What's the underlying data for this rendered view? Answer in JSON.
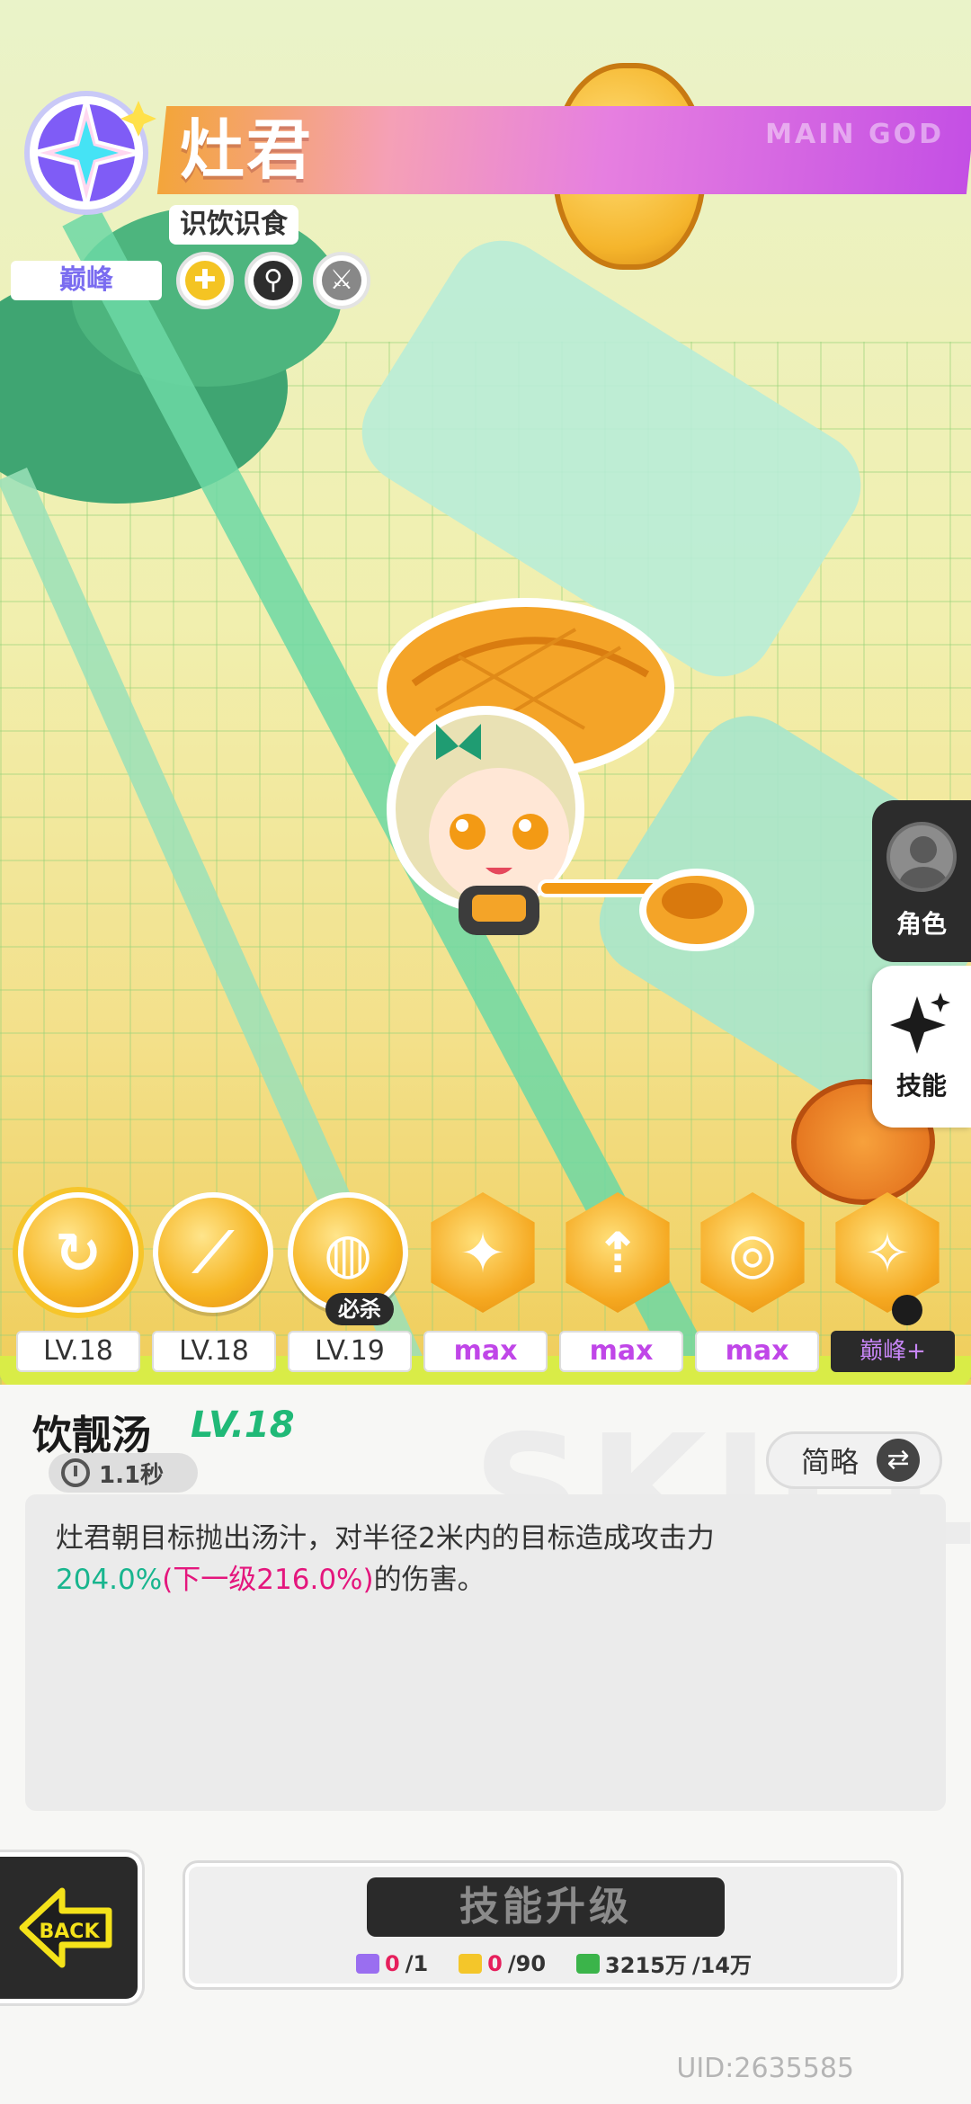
{
  "header": {
    "name": "灶君",
    "subtitle": "识饮识食",
    "tier": "巅峰",
    "brand_watermark": "MAIN GOD",
    "traits": [
      {
        "icon": "puzzle-icon",
        "label": "✚"
      },
      {
        "icon": "search-icon",
        "label": "⚲"
      },
      {
        "icon": "sword-icon",
        "label": "⚔"
      }
    ]
  },
  "side_tabs": [
    {
      "label": "角色",
      "icon": "avatar-icon"
    },
    {
      "label": "技能",
      "icon": "sparkle-icon"
    }
  ],
  "skills": {
    "icons": [
      {
        "name": "skill-1-icon",
        "glyph": "↻"
      },
      {
        "name": "skill-2-icon",
        "glyph": "⟋"
      },
      {
        "name": "skill-3-icon",
        "glyph": "◍"
      },
      {
        "name": "skill-4-icon",
        "glyph": "✦"
      },
      {
        "name": "skill-5-icon",
        "glyph": "⇡"
      },
      {
        "name": "skill-6-icon",
        "glyph": "◎"
      },
      {
        "name": "skill-7-icon",
        "glyph": "✧"
      }
    ],
    "ult_tag": "必杀",
    "levels": [
      "LV.18",
      "LV.18",
      "LV.19",
      "max",
      "max",
      "max",
      "巅峰+"
    ]
  },
  "detail": {
    "skill_name": "饮靓汤",
    "skill_level": "LV.18",
    "cooldown": "1.1秒",
    "brief_label": "简略",
    "desc_line1": "灶君朝目标抛出汤汁，对半径2米内的目标造成攻击力",
    "desc_value": "204.0%",
    "desc_next": "(下一级216.0%)",
    "desc_tail": "的伤害。",
    "watermark": "SKILL"
  },
  "upgrade": {
    "button_label": "技能升级",
    "costs": [
      {
        "have": "0",
        "need": "/1",
        "icon": "book-icon",
        "color": "#9a6ef0"
      },
      {
        "have": "0",
        "need": "/90",
        "icon": "token-icon",
        "color": "#f4c62a"
      },
      {
        "have": "3215万",
        "need": "/14万",
        "icon": "money-icon",
        "color": "#3bb44a"
      }
    ]
  },
  "back_label": "BACK",
  "uid": "UID:2635585",
  "colors": {
    "accent_green": "#20b977",
    "accent_pink": "#e4167d",
    "max_purple": "#c046e8",
    "gold": "#f6b420"
  }
}
